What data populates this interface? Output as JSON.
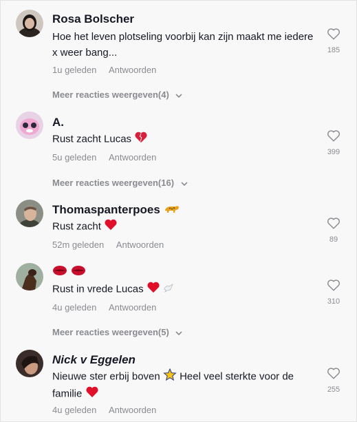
{
  "comments": [
    {
      "name": "Rosa Bolscher",
      "text": "Hoe het leven plotseling voorbij kan zijn maakt me iedere x weer bang...",
      "time": "1u geleden",
      "reply": "Antwoorden",
      "likes": "185",
      "more": "Meer reacties weergeven(4)"
    },
    {
      "name": "A.",
      "text": "Rust zacht Lucas",
      "time": "5u geleden",
      "reply": "Antwoorden",
      "likes": "399",
      "more": "Meer reacties weergeven(16)"
    },
    {
      "name": "Thomaspanterpoes",
      "text": "Rust zacht",
      "time": "52m geleden",
      "reply": "Antwoorden",
      "likes": "89"
    },
    {
      "name": "",
      "text": "Rust in vrede Lucas",
      "time": "4u geleden",
      "reply": "Antwoorden",
      "likes": "310",
      "more": "Meer reacties weergeven(5)"
    },
    {
      "name": "Nick v Eggelen",
      "text": "Nieuwe ster erbij boven",
      "text2": "Heel veel sterkte voor de familie",
      "time": "4u geleden",
      "reply": "Antwoorden",
      "likes": "255"
    }
  ],
  "icons": {
    "like": "heart-outline-icon",
    "expand": "chevron-down-icon",
    "red_heart": "red-heart-emoji",
    "broken_heart": "heart-emoji",
    "leopard": "leopard-emoji",
    "lips": "lips-emoji",
    "dove": "dove-emoji",
    "star": "star-emoji"
  },
  "colors": {
    "text": "#161823",
    "muted": "#8a8b91",
    "heart_red": "#e0102b"
  }
}
